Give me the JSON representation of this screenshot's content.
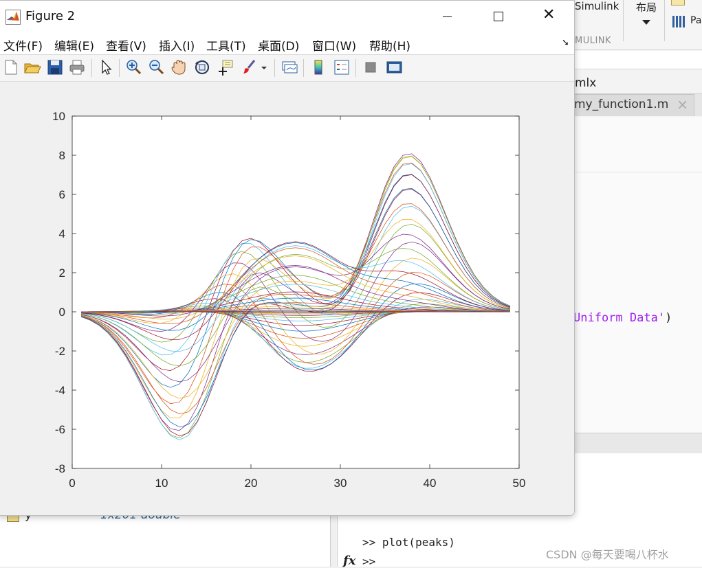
{
  "background": {
    "ribbon": {
      "simulink_label": "Simulink",
      "layout_label": "布局",
      "section_label": "MULINK",
      "pa_label": "Pa"
    },
    "file_name": "mlx",
    "editor_tab": {
      "label": "my_function1.m",
      "close": "×"
    },
    "code_fragment": {
      "string_part": "Uniform Data'",
      "tail": ")"
    },
    "workspace": {
      "var_name": "y",
      "var_value": "1x201 double"
    },
    "command_window": {
      "line1": ">> plot(peaks)",
      "line2": ">>",
      "fx": "fx"
    },
    "watermark": "CSDN @每天要喝八杯水"
  },
  "figure_window": {
    "title": "Figure 2",
    "controls": {
      "close": "✕"
    },
    "menu": [
      "文件(F)",
      "编辑(E)",
      "查看(V)",
      "插入(I)",
      "工具(T)",
      "桌面(D)",
      "窗口(W)",
      "帮助(H)"
    ],
    "toolbar_icons": [
      "new-figure-icon",
      "open-file-icon",
      "save-icon",
      "print-icon",
      "pointer-icon",
      "zoom-in-icon",
      "zoom-out-icon",
      "pan-hand-icon",
      "rotate-3d-icon",
      "data-cursor-icon",
      "brush-icon",
      "brush-dropdown-icon",
      "link-plot-icon",
      "colorbar-icon",
      "legend-icon",
      "hide-plot-tools-icon",
      "show-plot-tools-icon"
    ],
    "colors": {
      "accent_red": "#d83b01",
      "plot_border": "#262626"
    }
  },
  "chart_data": {
    "type": "line",
    "source": "peaks",
    "x_range": [
      1,
      49
    ],
    "xlim": [
      0,
      50
    ],
    "ylim": [
      -8,
      10
    ],
    "xticks": [
      0,
      10,
      20,
      30,
      40,
      50
    ],
    "yticks": [
      -8,
      -6,
      -4,
      -2,
      0,
      2,
      4,
      6,
      8,
      10
    ],
    "series_count": 49,
    "color_order": [
      "#0072BD",
      "#D95319",
      "#EDB120",
      "#7E2F8E",
      "#77AC30",
      "#4DBEEE",
      "#A2142F"
    ],
    "grid": false,
    "legend": "none",
    "title": "",
    "xlabel": "",
    "ylabel": ""
  }
}
